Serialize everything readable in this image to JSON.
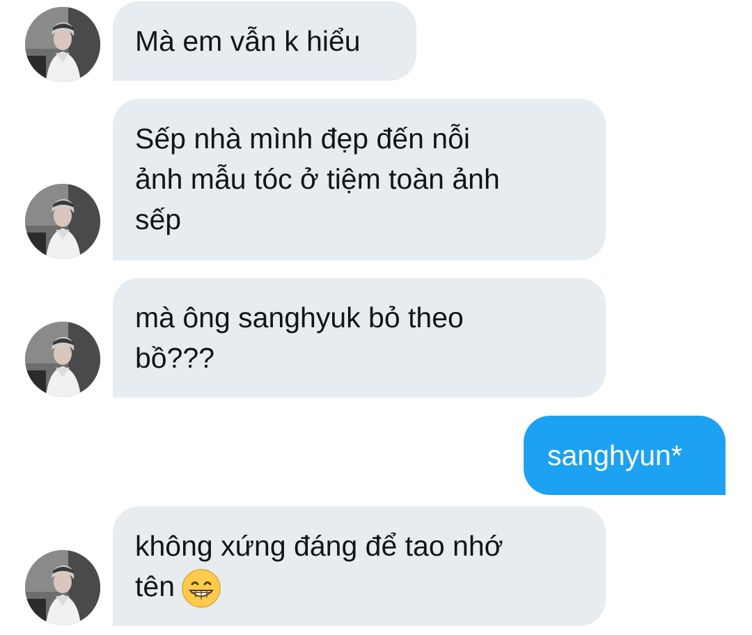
{
  "chat": {
    "messages": [
      {
        "direction": "incoming",
        "lines": [
          "Mà em vẫn k hiểu"
        ]
      },
      {
        "direction": "incoming",
        "lines": [
          "Sếp nhà mình đẹp đến nỗi",
          "ảnh mẫu tóc ở tiệm toàn ảnh",
          "sếp"
        ]
      },
      {
        "direction": "incoming",
        "lines": [
          "mà ông sanghyuk bỏ theo",
          "bồ???"
        ]
      },
      {
        "direction": "outgoing",
        "lines": [
          "sanghyun*"
        ]
      },
      {
        "direction": "incoming",
        "lines": [
          "không xứng đáng để tao nhớ",
          "tên"
        ],
        "emoji": "grinning-face-emoji"
      }
    ]
  },
  "colors": {
    "incoming_bubble": "#e6ecf0",
    "outgoing_bubble": "#1da1f2",
    "incoming_text": "#111418",
    "outgoing_text": "#ffffff"
  }
}
